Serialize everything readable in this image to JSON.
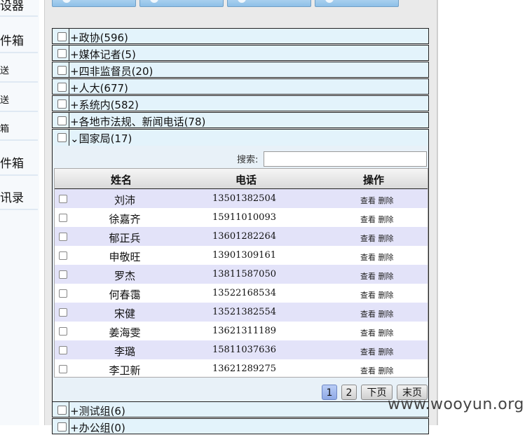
{
  "leftnav": {
    "items": [
      {
        "label": "设器"
      },
      {
        "label": "件箱"
      },
      {
        "label": "送"
      },
      {
        "label": "送"
      },
      {
        "label": "箱"
      },
      {
        "label": "件箱"
      },
      {
        "label": "讯录"
      }
    ]
  },
  "groups_before": [
    {
      "label": "+政协(596)"
    },
    {
      "label": "+媒体记者(5)"
    },
    {
      "label": "+四非监督员(20)"
    },
    {
      "label": "+人大(677)"
    },
    {
      "label": "+系统内(582)"
    },
    {
      "label": "+各地市法规、新闻电话(78)"
    },
    {
      "label": "⌄国家局(17)"
    }
  ],
  "search": {
    "label": "搜索:",
    "value": "",
    "placeholder": ""
  },
  "table": {
    "headers": {
      "name": "姓名",
      "phone": "电话",
      "actions": "操作"
    },
    "view_label": "查看",
    "delete_label": "删除",
    "rows": [
      {
        "name": "刘沛",
        "phone": "13501382504"
      },
      {
        "name": "徐嘉齐",
        "phone": "15911010093"
      },
      {
        "name": "郁正兵",
        "phone": "13601282264"
      },
      {
        "name": "申敬旺",
        "phone": "13901309161"
      },
      {
        "name": "罗杰",
        "phone": "13811587050"
      },
      {
        "name": "何春霭",
        "phone": "13522168534"
      },
      {
        "name": "宋健",
        "phone": "13521382554"
      },
      {
        "name": "姜海雯",
        "phone": "13621311189"
      },
      {
        "name": "李璐",
        "phone": "15811037636"
      },
      {
        "name": "李卫新",
        "phone": "13621289275"
      }
    ]
  },
  "pager": {
    "page1": "1",
    "page2": "2",
    "next": "下页",
    "last": "末页",
    "current": 1
  },
  "groups_after": [
    {
      "label": "+测试组(6)"
    },
    {
      "label": "+办公组(0)"
    }
  ],
  "watermark": "www.wooyun.org",
  "colors": {
    "group_bg": "#e3f3fb",
    "row_alt": "#e3e3f9",
    "current_page": "#9db3ec"
  }
}
